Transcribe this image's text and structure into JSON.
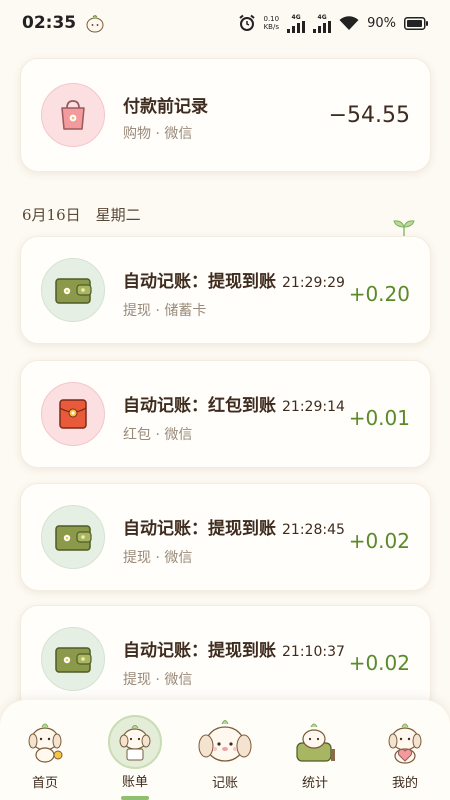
{
  "status_bar": {
    "time": "02:35",
    "speed_value": "0.10",
    "speed_unit": "KB/s",
    "signal1": "4G",
    "signal2": "4G",
    "battery": "90%"
  },
  "top_card": {
    "title": "付款前记录",
    "subtitle": "购物 · 微信",
    "amount": "−54.55",
    "icon": "shopping-bag-icon"
  },
  "date_header": "6月16日　星期二",
  "transactions": [
    {
      "title": "自动记账：提现到账",
      "time": "21:29:29",
      "subtitle": "提现 · 储蓄卡",
      "amount": "+0.20",
      "icon": "wallet-icon"
    },
    {
      "title": "自动记账：红包到账",
      "time": "21:29:14",
      "subtitle": "红包 · 微信",
      "amount": "+0.01",
      "icon": "red-envelope-icon"
    },
    {
      "title": "自动记账：提现到账",
      "time": "21:28:45",
      "subtitle": "提现 · 微信",
      "amount": "+0.02",
      "icon": "wallet-icon"
    },
    {
      "title": "自动记账：提现到账",
      "time": "21:10:37",
      "subtitle": "提现 · 微信",
      "amount": "+0.02",
      "icon": "wallet-icon"
    }
  ],
  "nav": {
    "items": [
      {
        "label": "首页",
        "icon": "puppy-home-icon"
      },
      {
        "label": "账单",
        "icon": "puppy-bill-icon",
        "active": true
      },
      {
        "label": "记账",
        "icon": "puppy-record-icon"
      },
      {
        "label": "统计",
        "icon": "puppy-stats-icon"
      },
      {
        "label": "我的",
        "icon": "puppy-profile-icon"
      }
    ]
  },
  "colors": {
    "background": "#fdfaf3",
    "positive": "#5a8a2a",
    "icon_pink": "#fcdfe0",
    "icon_green": "#e6efe4",
    "nav_active": "#e3edd8"
  }
}
